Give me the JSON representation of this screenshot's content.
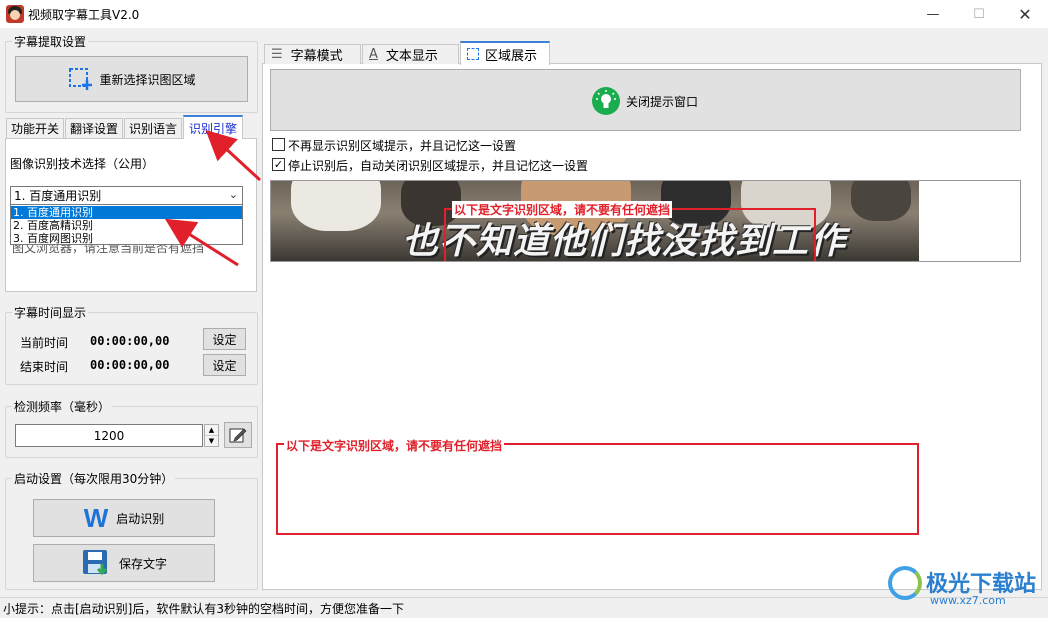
{
  "window": {
    "title": "视频取字幕工具V2.0",
    "min_glyph": "—",
    "max_glyph": "☐",
    "close_glyph": "✕"
  },
  "left": {
    "extract_group": {
      "label": "字幕提取设置",
      "reselect_button": "重新选择识图区域"
    },
    "tabs": [
      "功能开关",
      "翻译设置",
      "识别语言",
      "识别引擎"
    ],
    "active_tab": "识别引擎",
    "engine_panel": {
      "tech_label": "图像识别技术选择（公用）",
      "selected": "1. 百度通用识别",
      "options": [
        "1. 百度通用识别",
        "2. 百度高精识别",
        "3. 百度网图识别"
      ],
      "hidden_text": "图文浏览器，请注意当前是否有遮挡"
    },
    "time_group": {
      "label": "字幕时间显示",
      "current_label": "当前时间",
      "current_value": "00:00:00,00",
      "end_label": "结束时间",
      "end_value": "00:00:00,00",
      "set_button": "设定"
    },
    "freq_group": {
      "label": "检测频率（毫秒）",
      "value": "1200"
    },
    "start_group": {
      "label": "启动设置（每次限用30分钟）",
      "start_button": "启动识别",
      "save_button": "保存文字"
    }
  },
  "right": {
    "tabs": [
      "字幕模式",
      "文本显示",
      "区域展示"
    ],
    "active_tab": "区域展示",
    "close_tip_button": "关闭提示窗口",
    "checkbox1": {
      "label": "不再显示识别区域提示，并且记忆这一设置",
      "checked": false
    },
    "checkbox2": {
      "label": "停止识别后，自动关闭识别区域提示，并且记忆这一设置",
      "checked": true
    },
    "subtitle_text": "也不知道他们找没找到工作",
    "region_hint": "以下是文字识别区域，请不要有任何遮挡"
  },
  "status": {
    "hint": "小提示：点击[启动识别]后，软件默认有3秒钟的空档时间，方便您准备一下"
  },
  "watermark": {
    "name": "极光下载站",
    "url": "www.xz7.com"
  },
  "colors": {
    "accent": "#3c7fd7",
    "selection": "#0078d7",
    "region_red": "#e0202a",
    "bulb_green": "#1aad4e"
  }
}
